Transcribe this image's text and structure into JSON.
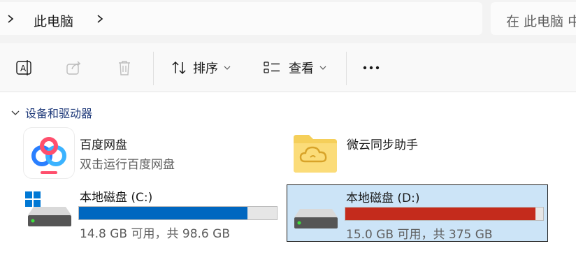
{
  "address": {
    "crumb": "此电脑",
    "search_placeholder": "在 此电脑 中"
  },
  "toolbar": {
    "sort_label": "排序",
    "view_label": "查看"
  },
  "group": {
    "title": "设备和驱动器"
  },
  "items": [
    {
      "title": "百度网盘",
      "subtitle": "双击运行百度网盘",
      "icon": "baidu-netdisk-icon"
    },
    {
      "title": "微云同步助手",
      "icon": "weiyun-folder-icon"
    }
  ],
  "drives": [
    {
      "title": "本地磁盘 (C:)",
      "status": "14.8 GB 可用，共 98.6 GB",
      "used_fraction": 0.85,
      "bar_color": "#0067c0",
      "icon": "windows-drive-icon"
    },
    {
      "title": "本地磁盘 (D:)",
      "status": "15.0 GB 可用，共 375 GB",
      "used_fraction": 0.96,
      "bar_color": "#c42b1c",
      "icon": "drive-icon"
    }
  ]
}
